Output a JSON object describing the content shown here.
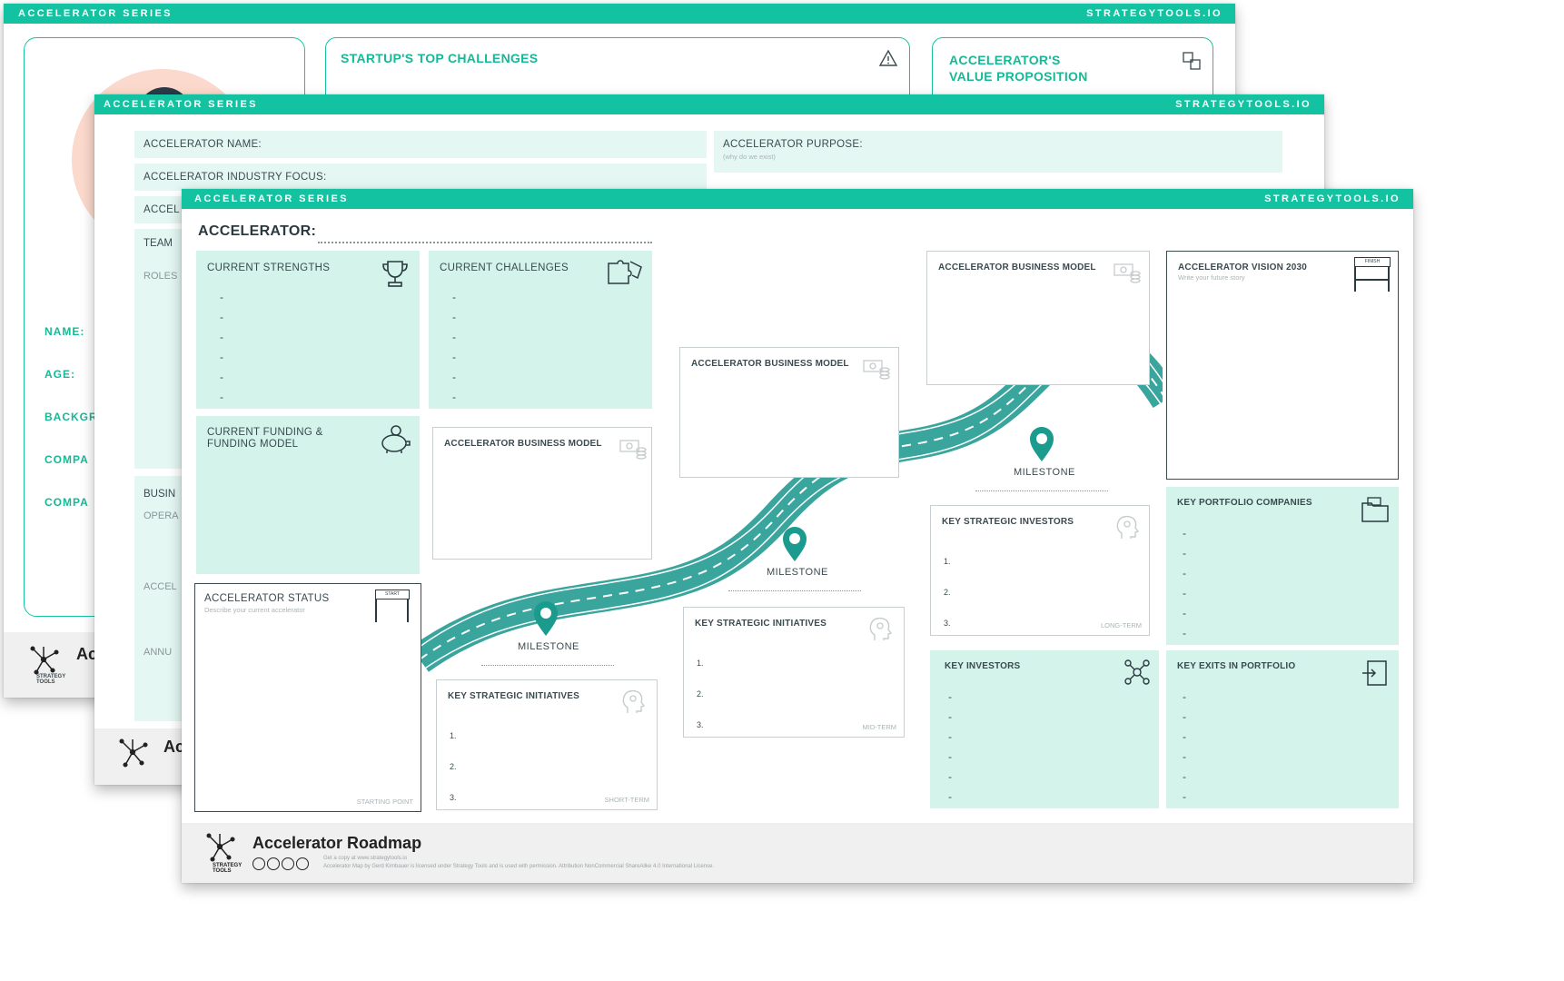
{
  "sheet_back": {
    "header_left": "ACCELERATOR SERIES",
    "header_right": "STRATEGYTOOLS.IO",
    "challenges_title": "STARTUP'S TOP CHALLENGES",
    "value_prop_line1": "ACCELERATOR'S",
    "value_prop_line2": "VALUE PROPOSITION",
    "fields": [
      "NAME:",
      "AGE:",
      "BACKGR",
      "COMPA",
      "COMPA"
    ],
    "footer_title": "Ac",
    "logo_text": "STRATEGY TOOLS"
  },
  "sheet_mid": {
    "header_left": "ACCELERATOR SERIES",
    "header_right": "STRATEGYTOOLS.IO",
    "name_label": "ACCELERATOR NAME:",
    "industry_label": "ACCELERATOR INDUSTRY FOCUS:",
    "third_label": "ACCEL",
    "purpose_label": "ACCELERATOR PURPOSE:",
    "purpose_hint": "(why do we exist)",
    "team_label": "TEAM",
    "roles_label": "ROLES",
    "busin_label": "BUSIN",
    "opera_label": "OPERA",
    "accel_label": "ACCEL",
    "annu_label": "ANNU",
    "footer_title": "Ac",
    "logo_text": "STRATEGY TOOLS"
  },
  "sheet_front": {
    "header_left": "ACCELERATOR SERIES",
    "header_right": "STRATEGYTOOLS.IO",
    "accelerator_label": "ACCELERATOR:",
    "strengths_title": "CURRENT STRENGTHS",
    "challenges_title": "CURRENT CHALLENGES",
    "funding_title_1": "CURRENT FUNDING &",
    "funding_title_2": "FUNDING MODEL",
    "status_title": "ACCELERATOR STATUS",
    "status_hint": "Describe your current accelerator",
    "status_corner": "STARTING POINT",
    "bm_title": "ACCELERATOR BUSINESS MODEL",
    "ksi_title": "KEY STRATEGIC INITIATIVES",
    "ksi_corner_short": "SHORT-TERM",
    "ksi_corner_mid": "MID-TERM",
    "ksinv_title": "KEY STRATEGIC INVESTORS",
    "ksinv_corner": "LONG-TERM",
    "vision_title": "ACCELERATOR VISION 2030",
    "vision_hint": "Write your future story",
    "portfolio_title": "KEY PORTFOLIO COMPANIES",
    "investors_title": "KEY INVESTORS",
    "exits_title": "KEY EXITS IN PORTFOLIO",
    "milestone": "MILESTONE",
    "bullet": "-",
    "n1": "1.",
    "n2": "2.",
    "n3": "3.",
    "footer_title": "Accelerator Roadmap",
    "footer_line1": "Get a copy at www.strategytools.io",
    "footer_line2": "Accelerator Map by Gerd Kirnbauer is licensed under Strategy Tools and is used with permission. Attribution NonCommercial ShareAlike 4.0 International License.",
    "logo_text": "STRATEGY TOOLS",
    "start_label": "START",
    "finish_label": "FINISH"
  }
}
